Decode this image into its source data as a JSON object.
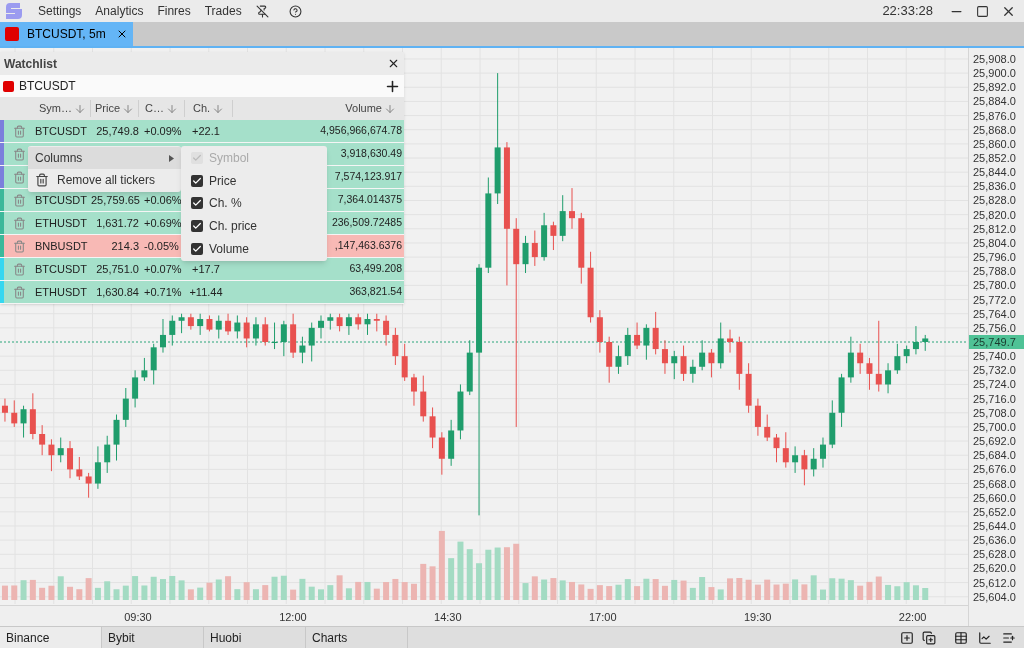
{
  "menu": [
    "Settings",
    "Analytics",
    "Finres",
    "Trades"
  ],
  "clock": "22:33:28",
  "tabs": [
    {
      "label": "BTCUSDT, 5m",
      "color": "#e00000",
      "selected": true
    }
  ],
  "watchlist": {
    "title": "Watchlist",
    "lists": [
      {
        "name": "BTCUSDT",
        "color": "#e00000"
      }
    ],
    "columns": [
      "Sym…",
      "Price",
      "C…",
      "Ch.",
      "Volume"
    ],
    "rows": [
      {
        "symbol": "BTCUSDT",
        "price": "25,749.8",
        "change": "+0.09%",
        "change_price": "+22.1",
        "volume": "4,956,966,674.78",
        "negative": false,
        "color": "#7b7fdc"
      },
      {
        "volume": "3,918,630.49",
        "negative": false,
        "color": "#7b7fdc"
      },
      {
        "volume": "7,574,123.917",
        "negative": false,
        "color": "#7b7fdc"
      },
      {
        "symbol": "BTCUSDT",
        "price": "25,759.65",
        "change": "+0.06%",
        "volume": "7,364.014375",
        "negative": false,
        "color": "#3cb89a"
      },
      {
        "symbol": "ETHUSDT",
        "price": "1,631.72",
        "change": "+0.69%",
        "volume": "236,509.72485",
        "negative": false,
        "color": "#3cb89a"
      },
      {
        "symbol": "BNBUSDT",
        "price": "214.3",
        "change": "-0.05%",
        "volume": ",147,463.6376",
        "negative": true,
        "color": "#3cb89a"
      },
      {
        "symbol": "BTCUSDT",
        "price": "25,751.0",
        "change": "+0.07%",
        "change_price": "+17.7",
        "volume": "63,499.208",
        "negative": false,
        "color": "#35d7f0"
      },
      {
        "symbol": "ETHUSDT",
        "price": "1,630.84",
        "change": "+0.71%",
        "change_price": "+11.44",
        "volume": "363,821.54",
        "negative": false,
        "color": "#35d7f0"
      }
    ]
  },
  "context_menu": [
    {
      "label": "Columns",
      "kind": "submenu",
      "selected": true
    },
    {
      "label": "Remove all tickers",
      "kind": "action",
      "selected": false
    }
  ],
  "columns_menu": [
    {
      "label": "Symbol",
      "checked": true,
      "disabled": true
    },
    {
      "label": "Price",
      "checked": true,
      "disabled": false
    },
    {
      "label": "Ch. %",
      "checked": true,
      "disabled": false
    },
    {
      "label": "Ch. price",
      "checked": true,
      "disabled": false
    },
    {
      "label": "Volume",
      "checked": true,
      "disabled": false
    }
  ],
  "chart": {
    "current_price": "25,749.7",
    "chart_data": {
      "type": "candlestick",
      "x": [
        7.35,
        7.5,
        7.65,
        7.8,
        7.95,
        8.1,
        8.25,
        8.4,
        8.55,
        8.7,
        8.85,
        9,
        9.15,
        9.3,
        9.45,
        9.6,
        9.75,
        9.9,
        10.05,
        10.2,
        10.35,
        10.5,
        10.65,
        10.8,
        10.95,
        11.1,
        11.25,
        11.4,
        11.55,
        11.7,
        11.85,
        12,
        12.15,
        12.3,
        12.45,
        12.6,
        12.75,
        12.9,
        13.05,
        13.2,
        13.35,
        13.5,
        13.65,
        13.8,
        13.95,
        14.1,
        14.25,
        14.4,
        14.55,
        14.7,
        14.85,
        15,
        15.15,
        15.3,
        15.45,
        15.6,
        15.75,
        15.9,
        16.05,
        16.2,
        16.35,
        16.5,
        16.65,
        16.8,
        16.95,
        17.1,
        17.25,
        17.4,
        17.55,
        17.7,
        17.85,
        18,
        18.15,
        18.3,
        18.45,
        18.6,
        18.75,
        18.9,
        19.05,
        19.2,
        19.35,
        19.5,
        19.65,
        19.8,
        19.95,
        20.1,
        20.25,
        20.4,
        20.55,
        20.7,
        20.85,
        21,
        21.15,
        21.3,
        21.45,
        21.6,
        21.75,
        21.9,
        22.05,
        22.2
      ],
      "ohlc": [
        [
          25712,
          25716,
          25703,
          25708
        ],
        [
          25708,
          25715,
          25700,
          25702
        ],
        [
          25702,
          25712,
          25694,
          25710
        ],
        [
          25710,
          25719,
          25693,
          25696
        ],
        [
          25696,
          25701,
          25684,
          25690
        ],
        [
          25690,
          25693,
          25675,
          25684
        ],
        [
          25684,
          25694,
          25680,
          25688
        ],
        [
          25688,
          25692,
          25671,
          25676
        ],
        [
          25676,
          25683,
          25670,
          25672
        ],
        [
          25672,
          25674,
          25660,
          25668
        ],
        [
          25668,
          25689,
          25665,
          25680
        ],
        [
          25680,
          25695,
          25674,
          25690
        ],
        [
          25690,
          25707,
          25681,
          25704
        ],
        [
          25704,
          25722,
          25700,
          25716
        ],
        [
          25716,
          25732,
          25711,
          25728
        ],
        [
          25728,
          25739,
          25726,
          25732
        ],
        [
          25732,
          25747,
          25724,
          25745
        ],
        [
          25745,
          25761,
          25742,
          25752
        ],
        [
          25752,
          25763,
          25746,
          25760
        ],
        [
          25760,
          25764,
          25753,
          25762
        ],
        [
          25762,
          25764,
          25755,
          25757
        ],
        [
          25757,
          25764,
          25752,
          25761
        ],
        [
          25761,
          25763,
          25754,
          25755
        ],
        [
          25755,
          25763,
          25750,
          25760
        ],
        [
          25760,
          25764,
          25752,
          25754
        ],
        [
          25754,
          25763,
          25750,
          25759
        ],
        [
          25759,
          25762,
          25745,
          25750
        ],
        [
          25750,
          25762,
          25746,
          25758
        ],
        [
          25758,
          25762,
          25746,
          25748
        ],
        [
          25748,
          25759,
          25744,
          25748
        ],
        [
          25748,
          25760,
          25740,
          25758
        ],
        [
          25758,
          25764,
          25739,
          25742
        ],
        [
          25742,
          25751,
          25736,
          25746
        ],
        [
          25746,
          25759,
          25737,
          25756
        ],
        [
          25756,
          25763,
          25750,
          25760
        ],
        [
          25760,
          25764,
          25755,
          25762
        ],
        [
          25762,
          25764,
          25754,
          25757
        ],
        [
          25757,
          25764,
          25752,
          25762
        ],
        [
          25762,
          25764,
          25755,
          25758
        ],
        [
          25758,
          25764,
          25752,
          25761
        ],
        [
          25761,
          25764,
          25754,
          25760
        ],
        [
          25760,
          25763,
          25746,
          25752
        ],
        [
          25752,
          25756,
          25735,
          25740
        ],
        [
          25740,
          25747,
          25726,
          25728
        ],
        [
          25728,
          25730,
          25712,
          25720
        ],
        [
          25720,
          25729,
          25703,
          25706
        ],
        [
          25706,
          25711,
          25688,
          25694
        ],
        [
          25694,
          25697,
          25673,
          25682
        ],
        [
          25682,
          25704,
          25678,
          25698
        ],
        [
          25698,
          25724,
          25693,
          25720
        ],
        [
          25720,
          25749,
          25718,
          25742
        ],
        [
          25742,
          25792,
          25650,
          25790
        ],
        [
          25790,
          25841,
          25787,
          25832
        ],
        [
          25832,
          25900,
          25826,
          25858
        ],
        [
          25858,
          25861,
          25780,
          25812
        ],
        [
          25812,
          25818,
          25700,
          25792
        ],
        [
          25792,
          25808,
          25787,
          25804
        ],
        [
          25804,
          25811,
          25791,
          25796
        ],
        [
          25796,
          25821,
          25794,
          25814
        ],
        [
          25814,
          25816,
          25800,
          25808
        ],
        [
          25808,
          25831,
          25805,
          25822
        ],
        [
          25822,
          25835,
          25812,
          25818
        ],
        [
          25818,
          25821,
          25781,
          25790
        ],
        [
          25790,
          25799,
          25759,
          25762
        ],
        [
          25762,
          25766,
          25742,
          25748
        ],
        [
          25748,
          25751,
          25725,
          25734
        ],
        [
          25734,
          25746,
          25730,
          25740
        ],
        [
          25740,
          25756,
          25735,
          25752
        ],
        [
          25752,
          25759,
          25744,
          25746
        ],
        [
          25746,
          25758,
          25738,
          25756
        ],
        [
          25756,
          25765,
          25741,
          25744
        ],
        [
          25744,
          25749,
          25730,
          25736
        ],
        [
          25736,
          25743,
          25727,
          25740
        ],
        [
          25740,
          25746,
          25726,
          25730
        ],
        [
          25730,
          25738,
          25725,
          25734
        ],
        [
          25734,
          25749,
          25732,
          25742
        ],
        [
          25742,
          25744,
          25728,
          25736
        ],
        [
          25736,
          25759,
          25733,
          25750
        ],
        [
          25750,
          25755,
          25742,
          25748
        ],
        [
          25748,
          25751,
          25721,
          25730
        ],
        [
          25730,
          25736,
          25708,
          25712
        ],
        [
          25712,
          25716,
          25695,
          25700
        ],
        [
          25700,
          25707,
          25692,
          25694
        ],
        [
          25694,
          25696,
          25680,
          25688
        ],
        [
          25688,
          25697,
          25677,
          25680
        ],
        [
          25680,
          25689,
          25674,
          25684
        ],
        [
          25684,
          25687,
          25667,
          25676
        ],
        [
          25676,
          25688,
          25672,
          25682
        ],
        [
          25682,
          25694,
          25677,
          25690
        ],
        [
          25690,
          25715,
          25688,
          25708
        ],
        [
          25708,
          25730,
          25700,
          25728
        ],
        [
          25728,
          25751,
          25725,
          25742
        ],
        [
          25742,
          25747,
          25730,
          25736
        ],
        [
          25736,
          25739,
          25721,
          25730
        ],
        [
          25730,
          25760,
          25720,
          25724
        ],
        [
          25724,
          25736,
          25719,
          25732
        ],
        [
          25732,
          25747,
          25730,
          25740
        ],
        [
          25740,
          25746,
          25736,
          25744
        ],
        [
          25744,
          25757,
          25741,
          25748
        ],
        [
          25748,
          25752,
          25743,
          25750
        ]
      ],
      "grid": true,
      "xlim": [
        7.27,
        22.89
      ],
      "ylim": [
        25599.9,
        25914.2
      ],
      "xticks": [
        {
          "value": 9.5,
          "label": "09:30"
        },
        {
          "value": 12,
          "label": "12:00"
        },
        {
          "value": 14.5,
          "label": "14:30"
        },
        {
          "value": 17,
          "label": "17:00"
        },
        {
          "value": 19.5,
          "label": "19:30"
        },
        {
          "value": 22,
          "label": "22:00"
        }
      ],
      "yticks": [
        {
          "value": 25908,
          "label": "25,908.0"
        },
        {
          "value": 25900,
          "label": "25,900.0"
        },
        {
          "value": 25892,
          "label": "25,892.0"
        },
        {
          "value": 25884,
          "label": "25,884.0"
        },
        {
          "value": 25876,
          "label": "25,876.0"
        },
        {
          "value": 25868,
          "label": "25,868.0"
        },
        {
          "value": 25860,
          "label": "25,860.0"
        },
        {
          "value": 25852,
          "label": "25,852.0"
        },
        {
          "value": 25844,
          "label": "25,844.0"
        },
        {
          "value": 25836,
          "label": "25,836.0"
        },
        {
          "value": 25828,
          "label": "25,828.0"
        },
        {
          "value": 25820,
          "label": "25,820.0"
        },
        {
          "value": 25812,
          "label": "25,812.0"
        },
        {
          "value": 25804,
          "label": "25,804.0"
        },
        {
          "value": 25796,
          "label": "25,796.0"
        },
        {
          "value": 25788,
          "label": "25,788.0"
        },
        {
          "value": 25780,
          "label": "25,780.0"
        },
        {
          "value": 25772,
          "label": "25,772.0"
        },
        {
          "value": 25764,
          "label": "25,764.0"
        },
        {
          "value": 25756,
          "label": "25,756.0"
        },
        {
          "value": 25740,
          "label": "25,740.0"
        },
        {
          "value": 25732,
          "label": "25,732.0"
        },
        {
          "value": 25724,
          "label": "25,724.0"
        },
        {
          "value": 25716,
          "label": "25,716.0"
        },
        {
          "value": 25708,
          "label": "25,708.0"
        },
        {
          "value": 25700,
          "label": "25,700.0"
        },
        {
          "value": 25692,
          "label": "25,692.0"
        },
        {
          "value": 25684,
          "label": "25,684.0"
        },
        {
          "value": 25676,
          "label": "25,676.0"
        },
        {
          "value": 25668,
          "label": "25,668.0"
        },
        {
          "value": 25660,
          "label": "25,660.0"
        },
        {
          "value": 25652,
          "label": "25,652.0"
        },
        {
          "value": 25644,
          "label": "25,644.0"
        },
        {
          "value": 25636,
          "label": "25,636.0"
        },
        {
          "value": 25628,
          "label": "25,628.0"
        },
        {
          "value": 25620,
          "label": "25,620.0"
        },
        {
          "value": 25612,
          "label": "25,612.0"
        },
        {
          "value": 25604,
          "label": "25,604.0"
        }
      ]
    }
  },
  "bottom_tabs": [
    {
      "label": "Binance",
      "selected": true
    },
    {
      "label": "Bybit",
      "selected": false
    },
    {
      "label": "Huobi",
      "selected": false
    },
    {
      "label": "Charts",
      "selected": false
    }
  ]
}
